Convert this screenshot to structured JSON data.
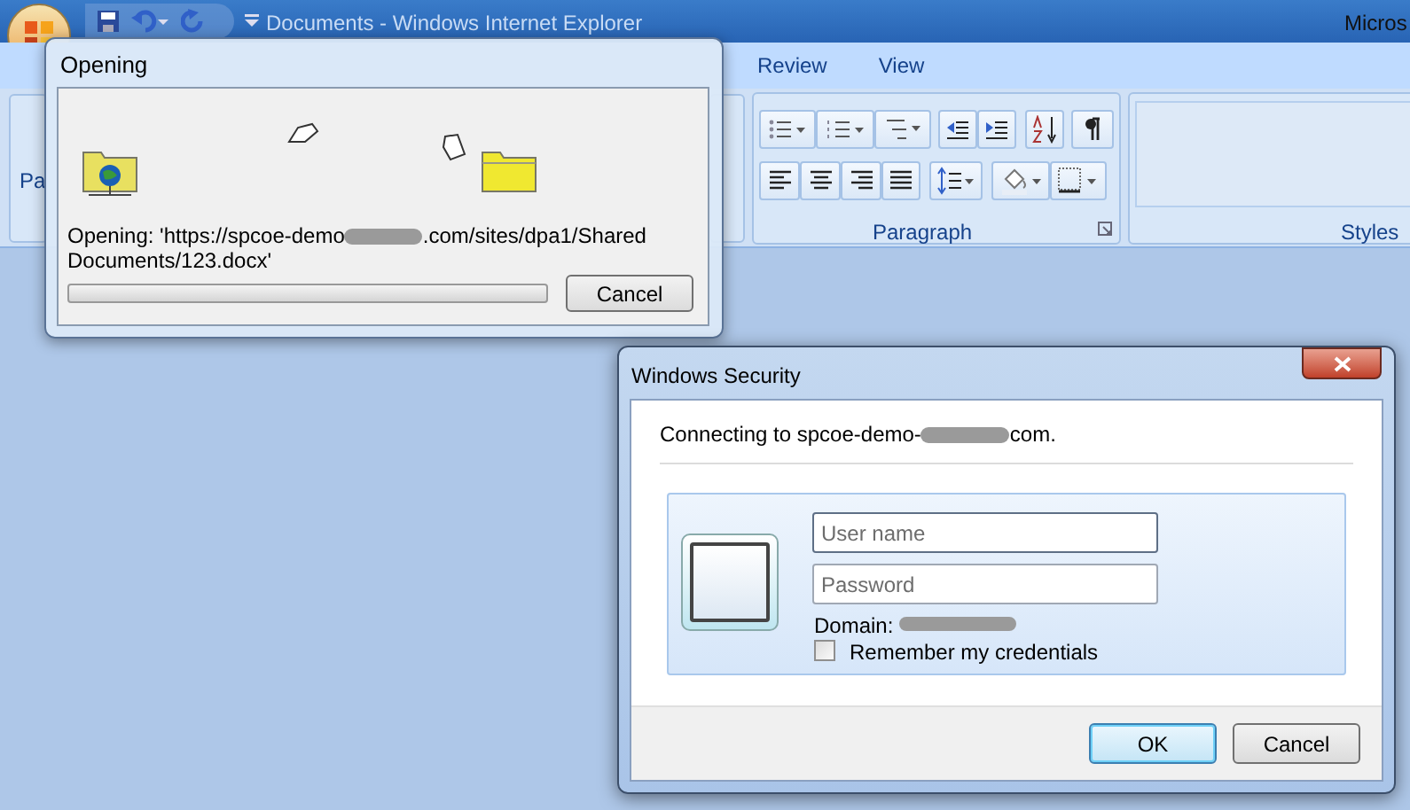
{
  "title_bar": {
    "faded_title": "Documents - Windows Internet Explorer",
    "title": "Micros"
  },
  "ribbon": {
    "tabs": [
      {
        "label": "Review",
        "selected": false
      },
      {
        "label": "View",
        "selected": false
      }
    ],
    "clipboard_label": "Pa",
    "paragraph_label": "Paragraph",
    "styles_label": "Styles"
  },
  "opening_dialog": {
    "title": "Opening",
    "message_before": "Opening: 'https://spcoe-demo",
    "message_after": ".com/sites/dpa1/Shared",
    "message_line2": "Documents/123.docx'",
    "progress": {
      "level": 0
    },
    "cancel": "Cancel"
  },
  "security_dialog": {
    "title": "Windows Security",
    "connecting_before": "Connecting to spcoe-demo-",
    "connecting_after": "com.",
    "username": {
      "placeholder": "User name"
    },
    "password": {
      "placeholder": "Password"
    },
    "domain_label": "Domain:",
    "remember": {
      "label": "Remember my credentials",
      "checked": false
    },
    "buttons": [
      {
        "label": "OK",
        "default": true
      },
      {
        "label": "Cancel",
        "default": false
      }
    ]
  }
}
